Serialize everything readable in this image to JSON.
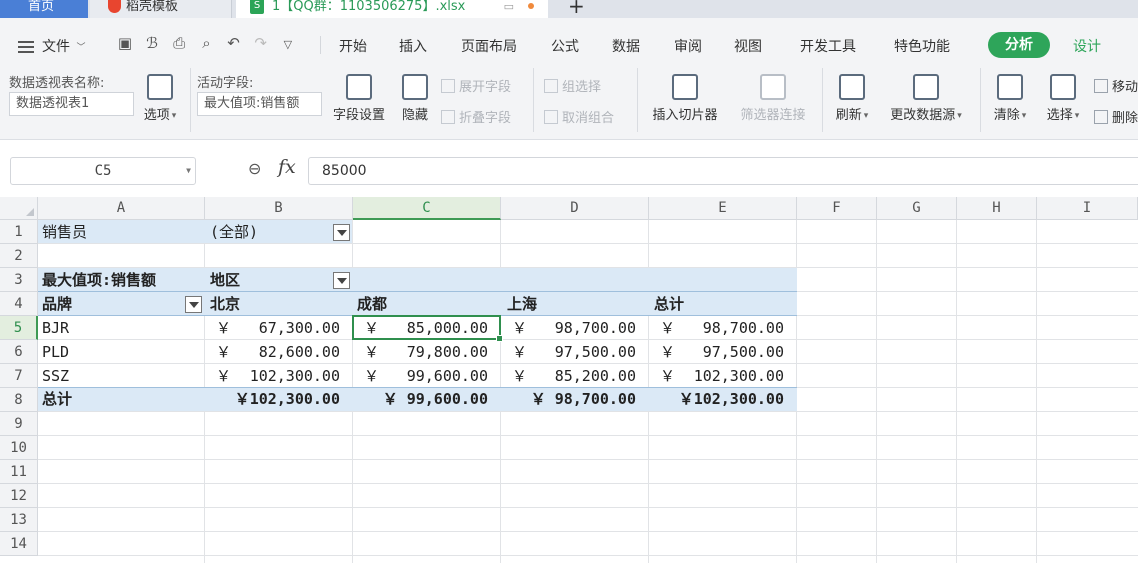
{
  "tabs": {
    "home": "首页",
    "template": "稻壳模板",
    "file": "1【QQ群：1103506275】.xlsx",
    "file_icon": "S",
    "add": "+"
  },
  "menu": {
    "file": "文件",
    "items": [
      "开始",
      "插入",
      "页面布局",
      "公式",
      "数据",
      "审阅",
      "视图",
      "开发工具",
      "特色功能"
    ],
    "analyze": "分析",
    "design": "设计"
  },
  "ribbon": {
    "pivot_name_label": "数据透视表名称:",
    "pivot_name_value": "数据透视表1",
    "options": "选项",
    "active_field_label": "活动字段:",
    "active_field_value": "最大值项:销售额",
    "field_settings": "字段设置",
    "hide": "隐藏",
    "expand_field": "展开字段",
    "collapse_field": "折叠字段",
    "group_selection": "组选择",
    "ungroup": "取消组合",
    "insert_slicer": "插入切片器",
    "filter_connections": "筛选器连接",
    "refresh": "刷新",
    "change_source": "更改数据源",
    "clear": "清除",
    "select": "选择",
    "move": "移动",
    "delete": "删除"
  },
  "formula_bar": {
    "name_box": "C5",
    "fx": "fx",
    "value": "85000"
  },
  "columns": [
    "A",
    "B",
    "C",
    "D",
    "E",
    "F",
    "G",
    "H",
    "I"
  ],
  "rows": [
    "1",
    "2",
    "3",
    "4",
    "5",
    "6",
    "7",
    "8",
    "9",
    "10",
    "11",
    "12",
    "13",
    "14"
  ],
  "pivot": {
    "filter_label": "销售员",
    "filter_value": "(全部)",
    "value_label": "最大值项:销售额",
    "col_field": "地区",
    "row_field": "品牌",
    "col_headers": [
      "北京",
      "成都",
      "上海",
      "总计"
    ],
    "currency": "￥",
    "body": [
      {
        "brand": "BJR",
        "values": [
          "67,300.00",
          "85,000.00",
          "98,700.00",
          "98,700.00"
        ]
      },
      {
        "brand": "PLD",
        "values": [
          "82,600.00",
          "79,800.00",
          "97,500.00",
          "97,500.00"
        ]
      },
      {
        "brand": "SSZ",
        "values": [
          "102,300.00",
          "99,600.00",
          "85,200.00",
          "102,300.00"
        ]
      }
    ],
    "total_label": "总计",
    "totals": [
      "￥102,300.00",
      "￥ 99,600.00",
      "￥ 98,700.00",
      "￥102,300.00"
    ]
  }
}
